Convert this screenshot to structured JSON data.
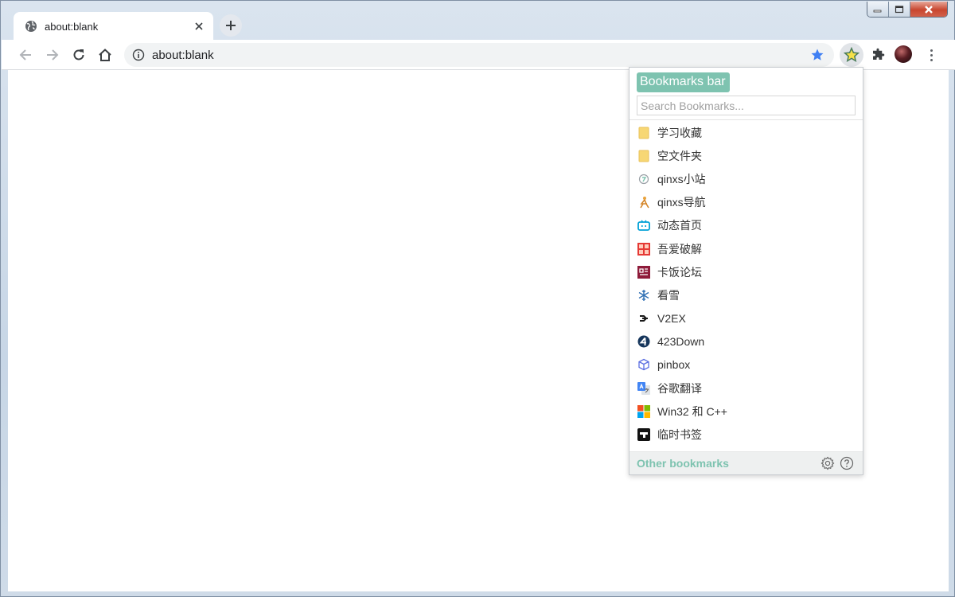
{
  "tab": {
    "title": "about:blank",
    "favicon": "globe-icon"
  },
  "omnibox": {
    "url": "about:blank"
  },
  "toolbar": {
    "back": "back-arrow-icon",
    "forward": "forward-arrow-icon",
    "reload": "reload-icon",
    "home": "home-icon",
    "bookmark_star": "star-icon",
    "extension_active": "star-extension-icon",
    "extensions": "puzzle-icon",
    "menu": "more-vert-icon"
  },
  "bookmarks": {
    "bar_label": "Bookmarks bar",
    "search_placeholder": "Search Bookmarks...",
    "items": [
      {
        "label": "学习收藏",
        "icon": "folder-icon"
      },
      {
        "label": "空文件夹",
        "icon": "folder-icon"
      },
      {
        "label": "qinxs小站",
        "icon": "qinxs-site-icon"
      },
      {
        "label": "qinxs导航",
        "icon": "qinxs-nav-icon"
      },
      {
        "label": "动态首页",
        "icon": "bilibili-icon"
      },
      {
        "label": "吾爱破解",
        "icon": "52pojie-icon"
      },
      {
        "label": "卡饭论坛",
        "icon": "kafan-icon"
      },
      {
        "label": "看雪",
        "icon": "snowflake-icon"
      },
      {
        "label": "V2EX",
        "icon": "v2ex-icon"
      },
      {
        "label": "423Down",
        "icon": "423down-icon"
      },
      {
        "label": "pinbox",
        "icon": "pinbox-icon"
      },
      {
        "label": "谷歌翻译",
        "icon": "google-translate-icon"
      },
      {
        "label": "Win32 和 C++",
        "icon": "microsoft-icon"
      },
      {
        "label": "临时书签",
        "icon": "temp-bookmark-icon"
      }
    ],
    "other_label": "Other bookmarks",
    "settings_icon": "gear-icon",
    "help_icon": "help-icon"
  },
  "colors": {
    "accent": "#7ec3b0",
    "folder": "#f7d774",
    "star": "#3f7ff3"
  }
}
